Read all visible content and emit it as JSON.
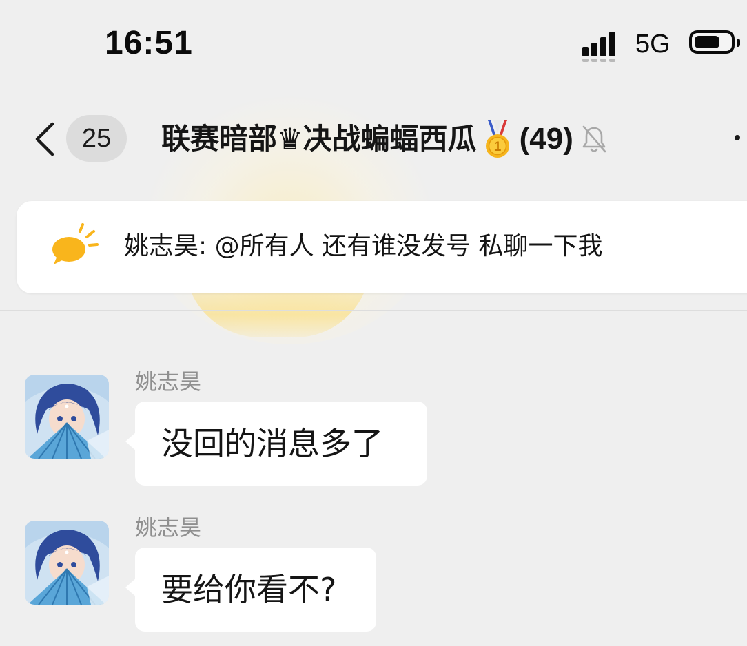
{
  "status_bar": {
    "time": "16:51",
    "network": "5G",
    "battery_level": 0.72,
    "signal_bars": 4
  },
  "header": {
    "unread_badge": "25",
    "title": "联赛暗部♛决战蝙蝠西瓜",
    "medal_icon": "gold-medal-1-icon",
    "member_count": "(49)",
    "muted_icon": "bell-off-icon"
  },
  "announcement": {
    "icon": "speech-bubble-icon",
    "text": "姚志昊: @所有人 还有谁没发号 私聊一下我"
  },
  "messages": [
    {
      "sender": "姚志昊",
      "text": "没回的消息多了"
    },
    {
      "sender": "姚志昊",
      "text": "要给你看不?"
    }
  ],
  "colors": {
    "background": "#efefef",
    "bubble": "#ffffff",
    "accent_yellow": "#f9b51c",
    "sender_gray": "#8f8f8f"
  }
}
